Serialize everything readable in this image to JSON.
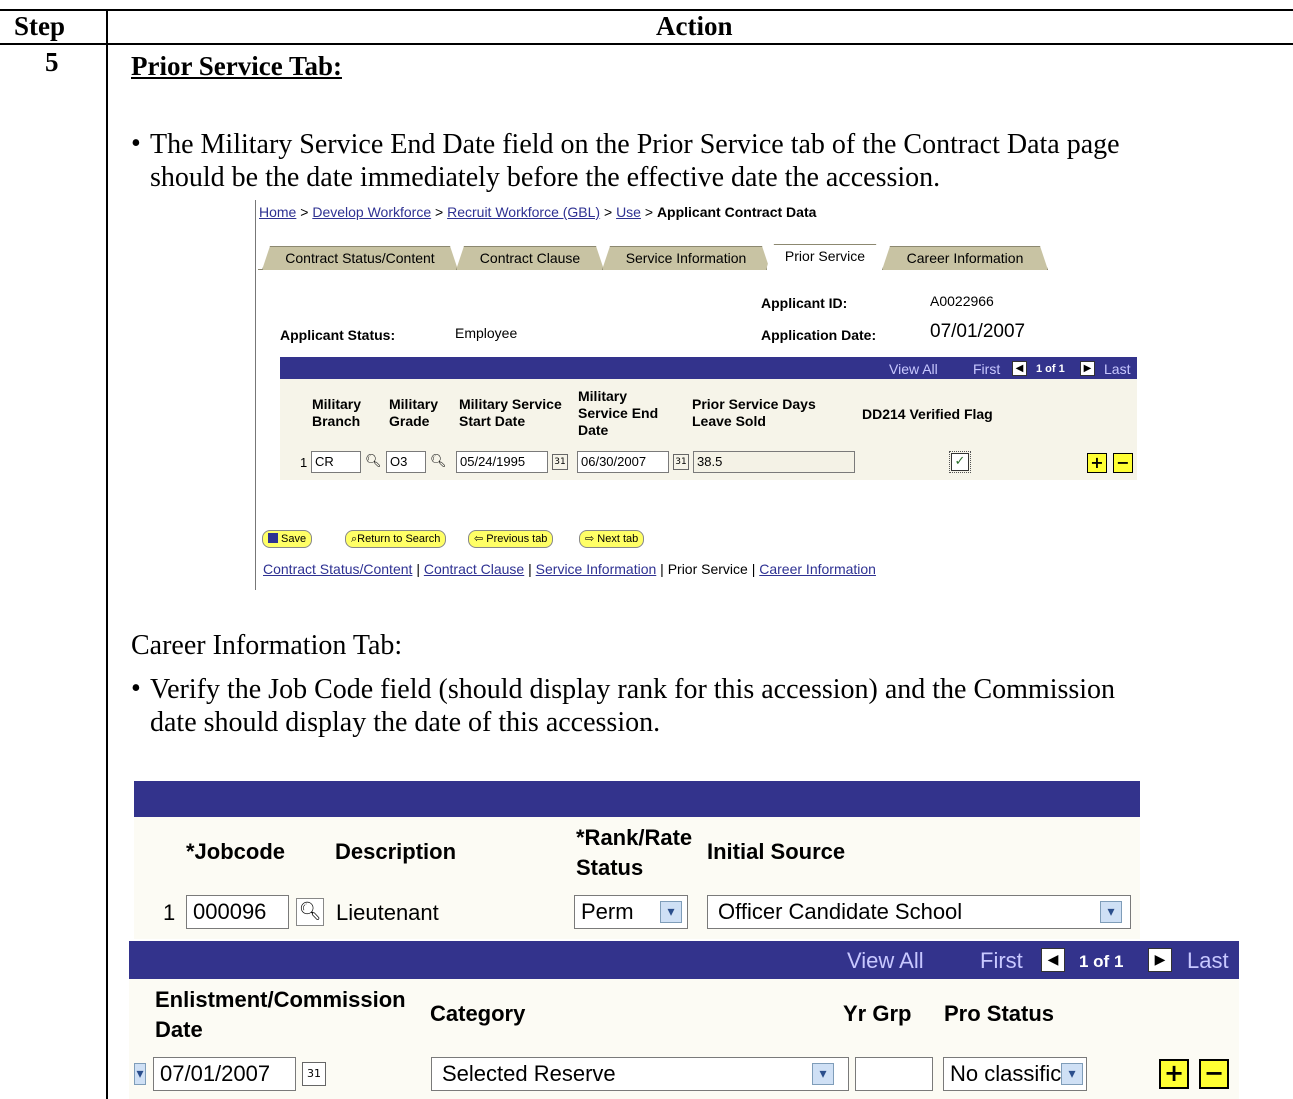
{
  "table": {
    "col_step": "Step",
    "col_action": "Action",
    "step_number": "5"
  },
  "section1": {
    "heading": "Prior Service Tab:",
    "bullet_line1": "The Military Service End Date field on the Prior Service tab of the Contract Data page",
    "bullet_line2": "should be the date immediately before the effective date the accession."
  },
  "screen1": {
    "breadcrumb": {
      "home": "Home",
      "develop": "Develop Workforce",
      "recruit": "Recruit Workforce (GBL)",
      "use": "Use",
      "current": "Applicant Contract Data",
      "sep": ">"
    },
    "tabs": [
      {
        "label": "Contract Status/Content"
      },
      {
        "label": "Contract Clause"
      },
      {
        "label": "Service Information"
      },
      {
        "label": "Prior Service"
      },
      {
        "label": "Career Information"
      }
    ],
    "applicant_id_label": "Applicant ID:",
    "applicant_id_value": "A0022966",
    "applicant_status_label": "Applicant Status:",
    "applicant_status_value": "Employee",
    "application_date_label": "Application Date:",
    "application_date_value": "07/01/2007",
    "nav": {
      "view_all": "View All",
      "first": "First",
      "counter": "1 of 1",
      "last": "Last"
    },
    "columns": {
      "branch": "Military Branch",
      "grade": "Military Grade",
      "start": "Military Service Start Date",
      "end": "Military Service End Date",
      "days": "Prior Service Days Leave Sold",
      "flag": "DD214 Verified Flag"
    },
    "row": {
      "num": "1",
      "branch": "CR",
      "grade": "O3",
      "start": "05/24/1995",
      "end": "06/30/2007",
      "days": "38.5",
      "verified": true
    },
    "buttons": {
      "save": "Save",
      "return": "Return to Search",
      "previous": "Previous tab",
      "next": "Next tab"
    },
    "footer_links": {
      "contract_status": "Contract Status/Content",
      "contract_clause": "Contract Clause",
      "service_information": "Service Information",
      "prior_service": "Prior Service",
      "career_information": "Career Information",
      "sep": "|"
    }
  },
  "section2": {
    "heading": "Career Information Tab:",
    "bullet_line1": "Verify the Job Code field (should display rank for this accession) and the Commission",
    "bullet_line2": "date should display the date of this accession."
  },
  "screen2": {
    "columns": {
      "jobcode": "*Jobcode",
      "description": "Description",
      "rank_line1": "*Rank/Rate",
      "rank_line2": "Status",
      "initial_source": "Initial Source"
    },
    "row": {
      "num": "1",
      "jobcode": "000096",
      "description": "Lieutenant",
      "rank_status": "Perm",
      "initial_source": "Officer Candidate School"
    },
    "nav": {
      "view_all": "View All",
      "first": "First",
      "counter": "1 of 1",
      "last": "Last"
    },
    "columns2": {
      "commission_line1": "Enlistment/Commission",
      "commission_line2": "Date",
      "category": "Category",
      "yr_grp": "Yr Grp",
      "pro_status": "Pro Status"
    },
    "row2": {
      "commission_date": "07/01/2007",
      "category": "Selected Reserve",
      "yr_grp": "",
      "pro_status": "No classific"
    }
  },
  "icons": {
    "bullet": "•",
    "lookup": "search-icon",
    "calendar": "calendar-icon",
    "dropdown": "chevron-down-icon",
    "add": "plus-icon",
    "remove": "minus-icon"
  },
  "colors": {
    "grid_header": "#33338c",
    "tab_bg": "#c8c3a3",
    "link": "#2e3192",
    "button_yellow": "#ffff33"
  }
}
